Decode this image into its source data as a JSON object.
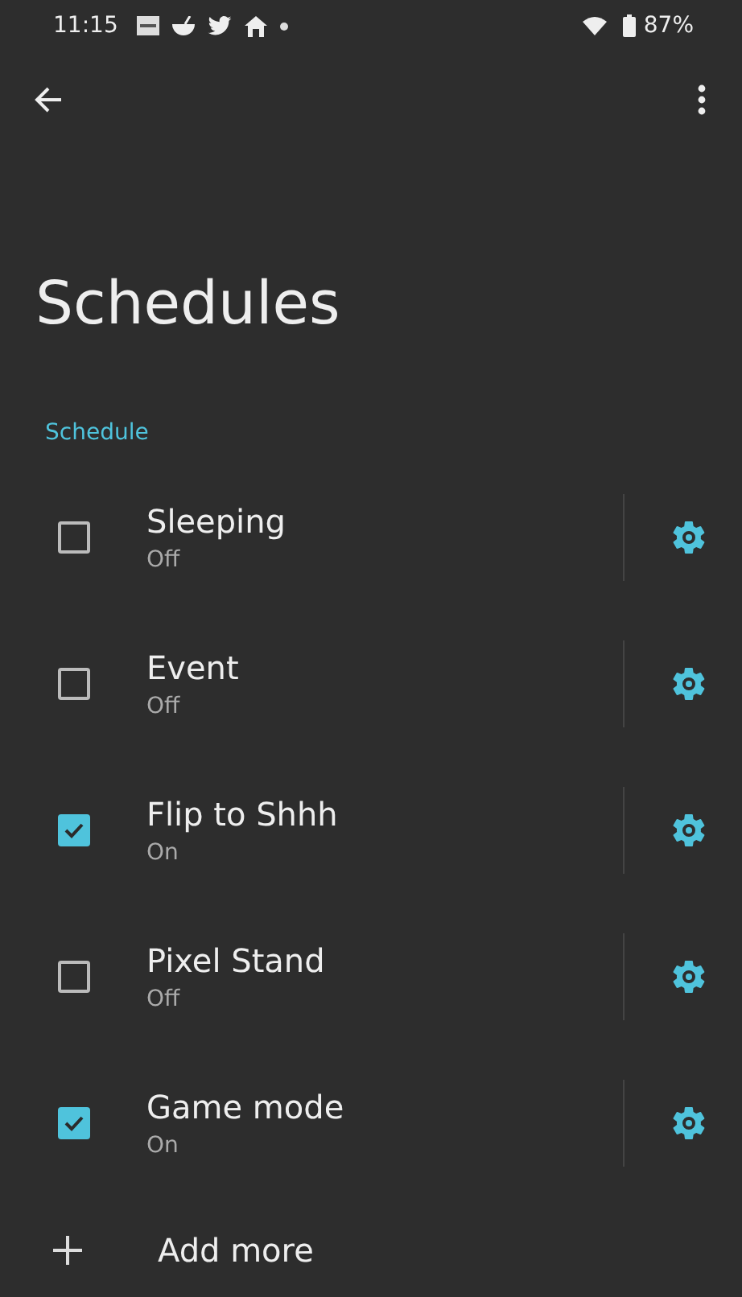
{
  "status_bar": {
    "time": "11:15",
    "battery": "87%"
  },
  "title": "Schedules",
  "section": "Schedule",
  "schedules": [
    {
      "name": "Sleeping",
      "status": "Off",
      "checked": false
    },
    {
      "name": "Event",
      "status": "Off",
      "checked": false
    },
    {
      "name": "Flip to Shhh",
      "status": "On",
      "checked": true
    },
    {
      "name": "Pixel Stand",
      "status": "Off",
      "checked": false
    },
    {
      "name": "Game mode",
      "status": "On",
      "checked": true
    }
  ],
  "add_button": "Add more"
}
